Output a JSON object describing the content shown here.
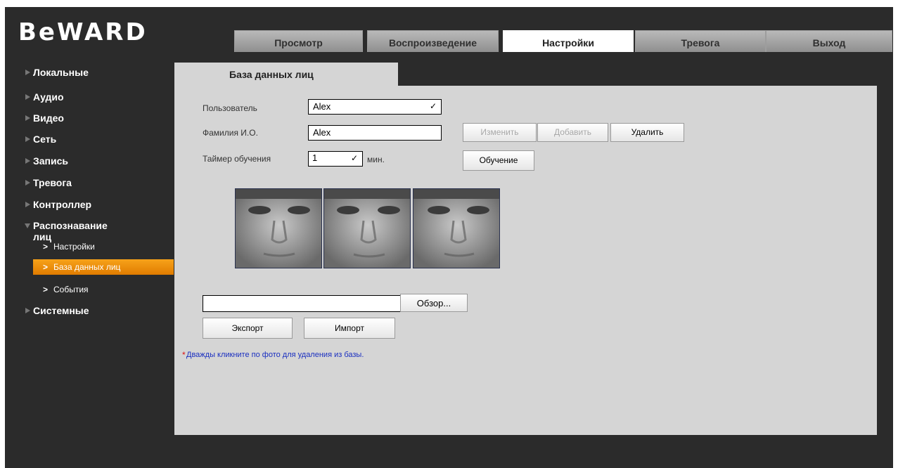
{
  "brand": {
    "logo": "BeWARD"
  },
  "top_tabs": [
    {
      "label": "Просмотр",
      "active": false
    },
    {
      "label": "Воспроизведение",
      "active": false
    },
    {
      "label": "Настройки",
      "active": true
    },
    {
      "label": "Тревога",
      "active": false
    },
    {
      "label": "Выход",
      "active": false
    }
  ],
  "sidebar": {
    "items": [
      {
        "label": "Локальные"
      },
      {
        "label": "Аудио"
      },
      {
        "label": "Видео"
      },
      {
        "label": "Сеть"
      },
      {
        "label": "Запись"
      },
      {
        "label": "Тревога"
      },
      {
        "label": "Контроллер"
      },
      {
        "label": "Распознавание лиц",
        "expanded": true
      },
      {
        "label": "Системные"
      }
    ],
    "subitems": [
      {
        "label": "Настройки",
        "active": false
      },
      {
        "label": "База данных лиц",
        "active": true
      },
      {
        "label": "События",
        "active": false
      }
    ]
  },
  "section": {
    "title": "База данных лиц"
  },
  "form": {
    "user_label": "Пользователь",
    "user_value": "Alex",
    "name_label": "Фамилия И.О.",
    "name_value": "Alex",
    "timer_label": "Таймер обучения",
    "timer_value": "1",
    "timer_unit": "мин.",
    "btn_change": "Изменить",
    "btn_add": "Добавить",
    "btn_delete": "Удалить",
    "btn_train": "Обучение"
  },
  "file": {
    "path_value": "",
    "browse": "Обзор..."
  },
  "actions": {
    "export": "Экспорт",
    "import": "Импорт"
  },
  "note": {
    "star": "*",
    "text": "Дважды кликните по фото для удаления из базы."
  },
  "icons": [
    "chevron-down-icon",
    "triangle-right-icon",
    "triangle-down-icon"
  ]
}
